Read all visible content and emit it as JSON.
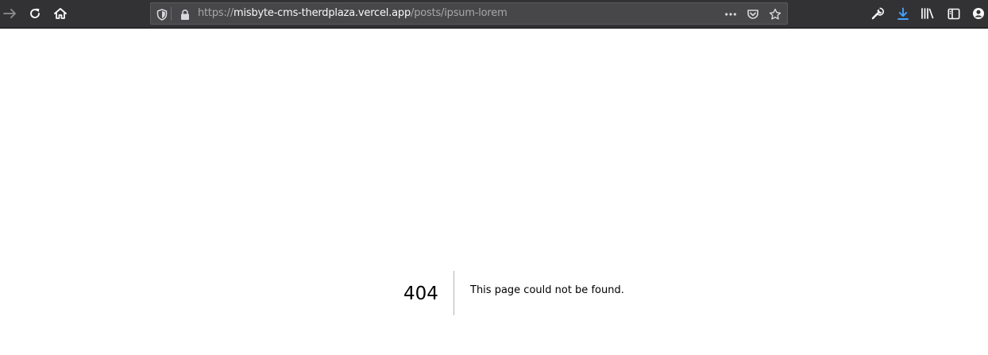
{
  "browser": {
    "url": {
      "scheme": "https://",
      "host": "misbyte-cms-therdplaza.vercel.app",
      "path": "/posts/ipsum-lorem"
    },
    "icons": {
      "forward": "forward-arrow-icon",
      "reload": "reload-icon",
      "home": "home-icon",
      "tracking": "shield-icon",
      "lock": "lock-icon",
      "page_actions": "more-dots-icon",
      "pocket": "pocket-icon",
      "bookmark": "star-icon",
      "devtools": "wrench-icon",
      "downloads": "download-icon",
      "library": "library-icon",
      "sidebar": "sidebar-icon",
      "account": "account-icon"
    },
    "colors": {
      "toolbar": "#323234",
      "urlbar": "#474749",
      "download_accent": "#45a1ff"
    }
  },
  "page": {
    "error_code": "404",
    "error_message": "This page could not be found."
  }
}
